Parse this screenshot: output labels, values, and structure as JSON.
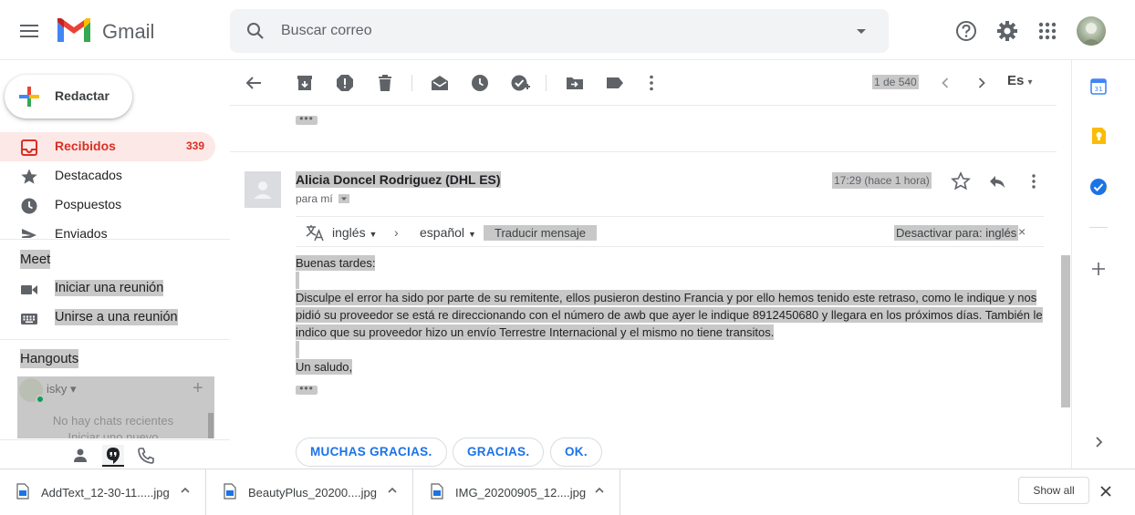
{
  "app": {
    "name": "Gmail"
  },
  "search": {
    "placeholder": "Buscar correo"
  },
  "compose": {
    "label": "Redactar"
  },
  "nav": {
    "inbox": {
      "label": "Recibidos",
      "count": "339"
    },
    "starred": {
      "label": "Destacados"
    },
    "snoozed": {
      "label": "Pospuestos"
    },
    "sent": {
      "label": "Enviados"
    }
  },
  "meet": {
    "title": "Meet",
    "new_meeting": "Iniciar una reunión",
    "join_meeting": "Unirse a una reunión"
  },
  "hangouts": {
    "title": "Hangouts",
    "user": "isky",
    "user_caret": "▾",
    "add": "+",
    "no_chats": "No hay chats recientes",
    "start_new": "Iniciar uno nuevo"
  },
  "toolbar": {
    "pager": "1 de 540",
    "input_tools": "Es",
    "input_tools_caret": "▾"
  },
  "message": {
    "collapsed_ellipsis": "•••",
    "sender": "Alicia Doncel Rodriguez (DHL ES)",
    "to": "para mí",
    "time": "17:29 (hace 1 hora)",
    "translate": {
      "from": "inglés",
      "arrow": "›",
      "to": "español",
      "translate_link": "Traducir mensaje",
      "disable_link": "Desactivar para: inglés",
      "close": "×"
    },
    "body": {
      "greeting": "Buenas tardes:",
      "paragraph": "Disculpe el error ha sido por parte de su remitente, ellos pusieron destino Francia y por ello hemos tenido este retraso, como le indique y nos pidió su proveedor se está re direccionando con el número de awb que ayer le indique 8912450680 y llegara en los próximos días. También le indico que su proveedor hizo un envío Terrestre Internacional y el mismo no tiene transitos.",
      "closing": "Un saludo,",
      "ellipsis": "•••"
    },
    "smart_replies": [
      "MUCHAS GRACIAS.",
      "GRACIAS.",
      "OK."
    ]
  },
  "downloads": {
    "items": [
      {
        "name": "AddText_12-30-11.....jpg"
      },
      {
        "name": "BeautyPlus_20200....jpg"
      },
      {
        "name": "IMG_20200905_12....jpg"
      }
    ],
    "show_all": "Show all"
  },
  "colors": {
    "accent_blue": "#1a73e8",
    "inbox_red": "#d93025",
    "highlight_gray": "#c8c8c8"
  },
  "icons": {
    "header": [
      "menu-icon",
      "gmail-logo-icon",
      "search-icon",
      "dropdown-caret-icon",
      "help-icon",
      "gear-icon",
      "apps-grid-icon"
    ],
    "toolbar": [
      "back-arrow-icon",
      "archive-icon",
      "report-spam-icon",
      "trash-icon",
      "mark-unread-icon",
      "snooze-icon",
      "add-task-icon",
      "move-to-icon",
      "label-icon",
      "more-vert-icon",
      "chevron-left-icon",
      "chevron-right-icon"
    ],
    "side_panel": [
      "calendar-icon",
      "keep-icon",
      "tasks-icon",
      "add-icon",
      "chevron-right-icon"
    ]
  }
}
